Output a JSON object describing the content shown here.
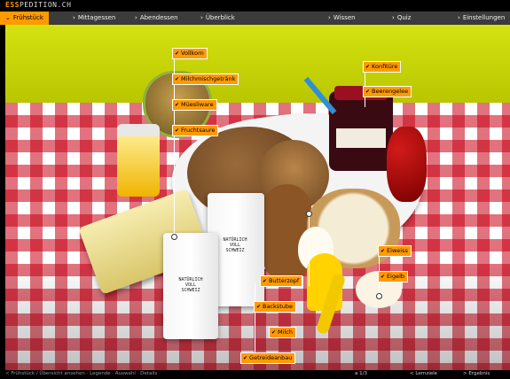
{
  "brand": {
    "prefix": "ESS",
    "suffix": "PEDITION.CH"
  },
  "nav": {
    "tabs": [
      {
        "label": "Frühstück"
      },
      {
        "label": "Mittagessen"
      },
      {
        "label": "Abendessen"
      },
      {
        "label": "Überblick"
      },
      {
        "label": "Wissen"
      },
      {
        "label": "Quiz"
      },
      {
        "label": "Einstellungen"
      }
    ]
  },
  "callouts": [
    {
      "label": "Vollkorn"
    },
    {
      "label": "Milchmischgetränk"
    },
    {
      "label": "Müesliware"
    },
    {
      "label": "Fruchtsaure"
    },
    {
      "label": "Konfitüre"
    },
    {
      "label": "Beerengelee"
    },
    {
      "label": "Eiweiss"
    },
    {
      "label": "Eigelb"
    },
    {
      "label": "Butterzopf"
    },
    {
      "label": "Backstube"
    },
    {
      "label": "Milch"
    },
    {
      "label": "Getreideanbau"
    }
  ],
  "glass_text": "NATÜRLICH\nVOLL\nSCHWEIZ",
  "footer": {
    "left_text": "< Frühstück / Übersicht ansehen · Legende · Auswahl · Details",
    "page": "a 1/3",
    "prev": "< Lernziele",
    "next": "> Ergebnis"
  },
  "colors": {
    "accent": "#ff9a00",
    "navbar": "#3b3b3b",
    "wall": "#c7d400",
    "cloth_red": "#c80014"
  }
}
